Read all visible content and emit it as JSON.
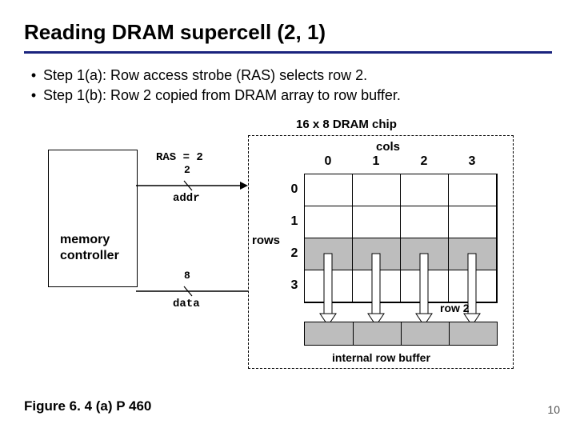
{
  "title": "Reading DRAM supercell (2, 1)",
  "bullets": [
    "Step 1(a): Row access strobe (RAS) selects row 2.",
    "Step 1(b): Row 2 copied from DRAM array to row buffer."
  ],
  "diagram": {
    "chip_label": "16 x 8 DRAM chip",
    "cols_label": "cols",
    "rows_label": "rows",
    "col_heads": [
      "0",
      "1",
      "2",
      "3"
    ],
    "row_heads": [
      "0",
      "1",
      "2",
      "3"
    ],
    "shaded_row_index": 2,
    "ras_text": "RAS = 2",
    "addr_bits": "2",
    "addr_label": "addr",
    "data_bits": "8",
    "data_label": "data",
    "mc_line1": "memory",
    "mc_line2": "controller",
    "row2_label": "row 2",
    "row_buffer_label": "internal row buffer"
  },
  "figure_caption": "Figure 6. 4 (a)  P 460",
  "page_number": "10"
}
